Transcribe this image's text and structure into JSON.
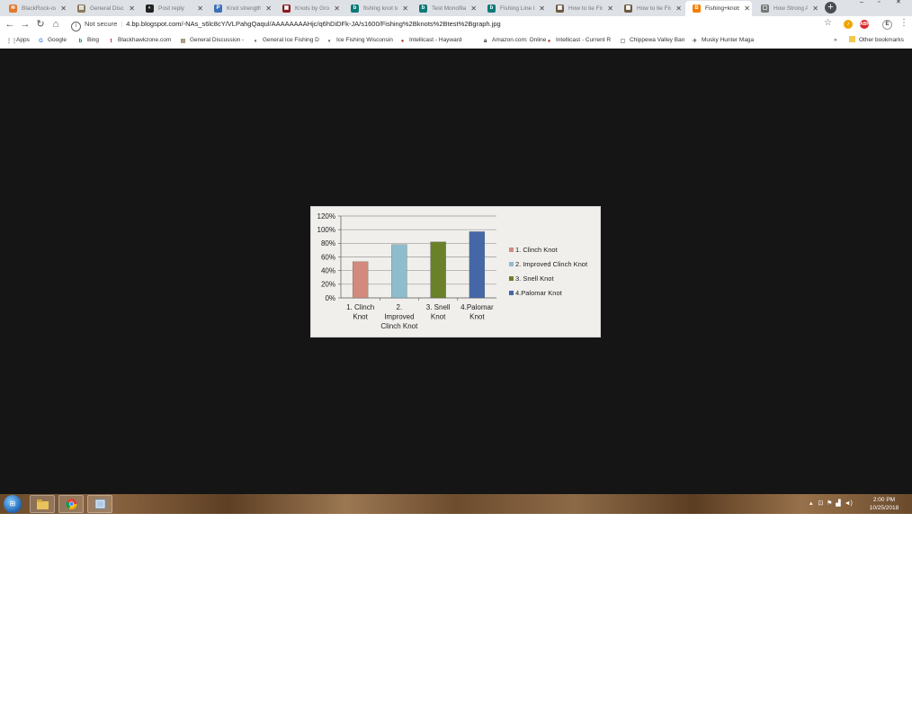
{
  "browser": {
    "tabs": [
      {
        "label": "BlackRock-own",
        "icon": "blackrock-favicon",
        "color": "#e07a2e",
        "glyph": "≋"
      },
      {
        "label": "General Discussion",
        "icon": "forum-favicon",
        "color": "#8a7b5a",
        "glyph": "▤"
      },
      {
        "label": "Post reply",
        "icon": "fishing-favicon",
        "color": "#222222",
        "glyph": "◐"
      },
      {
        "label": "Knot strength",
        "icon": "p-favicon",
        "color": "#3d6fb6",
        "glyph": "P"
      },
      {
        "label": "Knots by Group",
        "icon": "knots-favicon",
        "color": "#8b1a1a",
        "glyph": "▣"
      },
      {
        "label": "fishing knot test",
        "icon": "bing-favicon",
        "color": "#0d7a78",
        "glyph": "b"
      },
      {
        "label": "Test Monofilament",
        "icon": "bing-favicon",
        "color": "#0d7a78",
        "glyph": "b"
      },
      {
        "label": "Fishing Line Knots",
        "icon": "bing-favicon",
        "color": "#0d7a78",
        "glyph": "b"
      },
      {
        "label": "How to tie Fishing",
        "icon": "image-favicon",
        "color": "#6b5a40",
        "glyph": "▦"
      },
      {
        "label": "How to tie Fishing",
        "icon": "image-favicon",
        "color": "#6b5a40",
        "glyph": "▦"
      },
      {
        "label": "Fishing+knots",
        "icon": "blogger-favicon",
        "color": "#f57d00",
        "glyph": "B",
        "active": true
      },
      {
        "label": "How Strong Are",
        "icon": "page-favicon",
        "color": "#777777",
        "glyph": "▢"
      }
    ],
    "address": {
      "security": "Not secure",
      "url": "4.bp.blogspot.com/-NAs_s6lc8cY/VLPahgQaqul/AAAAAAAAHjc/q6hDiDFk-JA/s1600/Fishing%2Bknots%2Btest%2Bgraph.jpg"
    },
    "profile_initial": "E",
    "bookmarks": [
      {
        "label": "Apps",
        "icon": "apps-icon",
        "color": "#555555",
        "glyph": "⋮⋮"
      },
      {
        "label": "Google",
        "icon": "google-icon",
        "color": "#4285f4",
        "glyph": "G"
      },
      {
        "label": "Bing",
        "icon": "bing-icon",
        "color": "#0d7a78",
        "glyph": "b"
      },
      {
        "label": "Blackhawkzone.com",
        "icon": "blackhawk-icon",
        "color": "#b22222",
        "glyph": "t"
      },
      {
        "label": "General Discussion -",
        "icon": "forum-icon",
        "color": "#8a7b5a",
        "glyph": "▤"
      },
      {
        "label": "General Ice Fishing D",
        "icon": "fishing-icon",
        "color": "#222222",
        "glyph": "◐"
      },
      {
        "label": "Ice Fishing Wisconsin",
        "icon": "fishing-icon",
        "color": "#222222",
        "glyph": "◐"
      },
      {
        "label": "Intellicast - Hayward",
        "icon": "intellicast-icon",
        "color": "#c0392b",
        "glyph": "●"
      },
      {
        "label": "Amazon.com: Online",
        "icon": "amazon-icon",
        "color": "#222222",
        "glyph": "a"
      },
      {
        "label": "Intellicast - Current R",
        "icon": "intellicast-icon",
        "color": "#c0392b",
        "glyph": "●"
      },
      {
        "label": "Chippewa Valley Ban",
        "icon": "page-icon",
        "color": "#777777",
        "glyph": "▢"
      },
      {
        "label": "Musky Hunter Maga",
        "icon": "musky-icon",
        "color": "#555555",
        "glyph": "✈"
      }
    ],
    "other_bookmarks": "Other bookmarks",
    "overflow": "»"
  },
  "chart_data": {
    "type": "bar",
    "categories": [
      "1. Clinch Knot",
      "2. Improved Clinch Knot",
      "3. Snell Knot",
      "4.Palomar Knot"
    ],
    "category_lines": [
      [
        "1. Clinch",
        "Knot"
      ],
      [
        "2.",
        "Improved",
        "Clinch Knot"
      ],
      [
        "3. Snell",
        "Knot"
      ],
      [
        "4.Palomar",
        "Knot"
      ]
    ],
    "values": [
      53,
      78,
      82,
      97
    ],
    "value_unit": "%",
    "ylim": [
      0,
      120
    ],
    "yticks": [
      "0%",
      "20%",
      "40%",
      "60%",
      "80%",
      "100%",
      "120%"
    ],
    "colors": [
      "#d38a7e",
      "#8ebdcd",
      "#6b8129",
      "#4567a8"
    ],
    "legend": [
      "1. Clinch Knot",
      "2. Improved Clinch Knot",
      "3. Snell Knot",
      "4.Palomar Knot"
    ],
    "legend_placement": "right",
    "grid": true,
    "title": "",
    "xlabel": "",
    "ylabel": ""
  },
  "taskbar": {
    "apps": [
      {
        "icon": "file-explorer-icon"
      },
      {
        "icon": "chrome-icon"
      },
      {
        "icon": "notepad-icon"
      }
    ],
    "time": "2:00 PM",
    "date": "10/25/2018"
  }
}
